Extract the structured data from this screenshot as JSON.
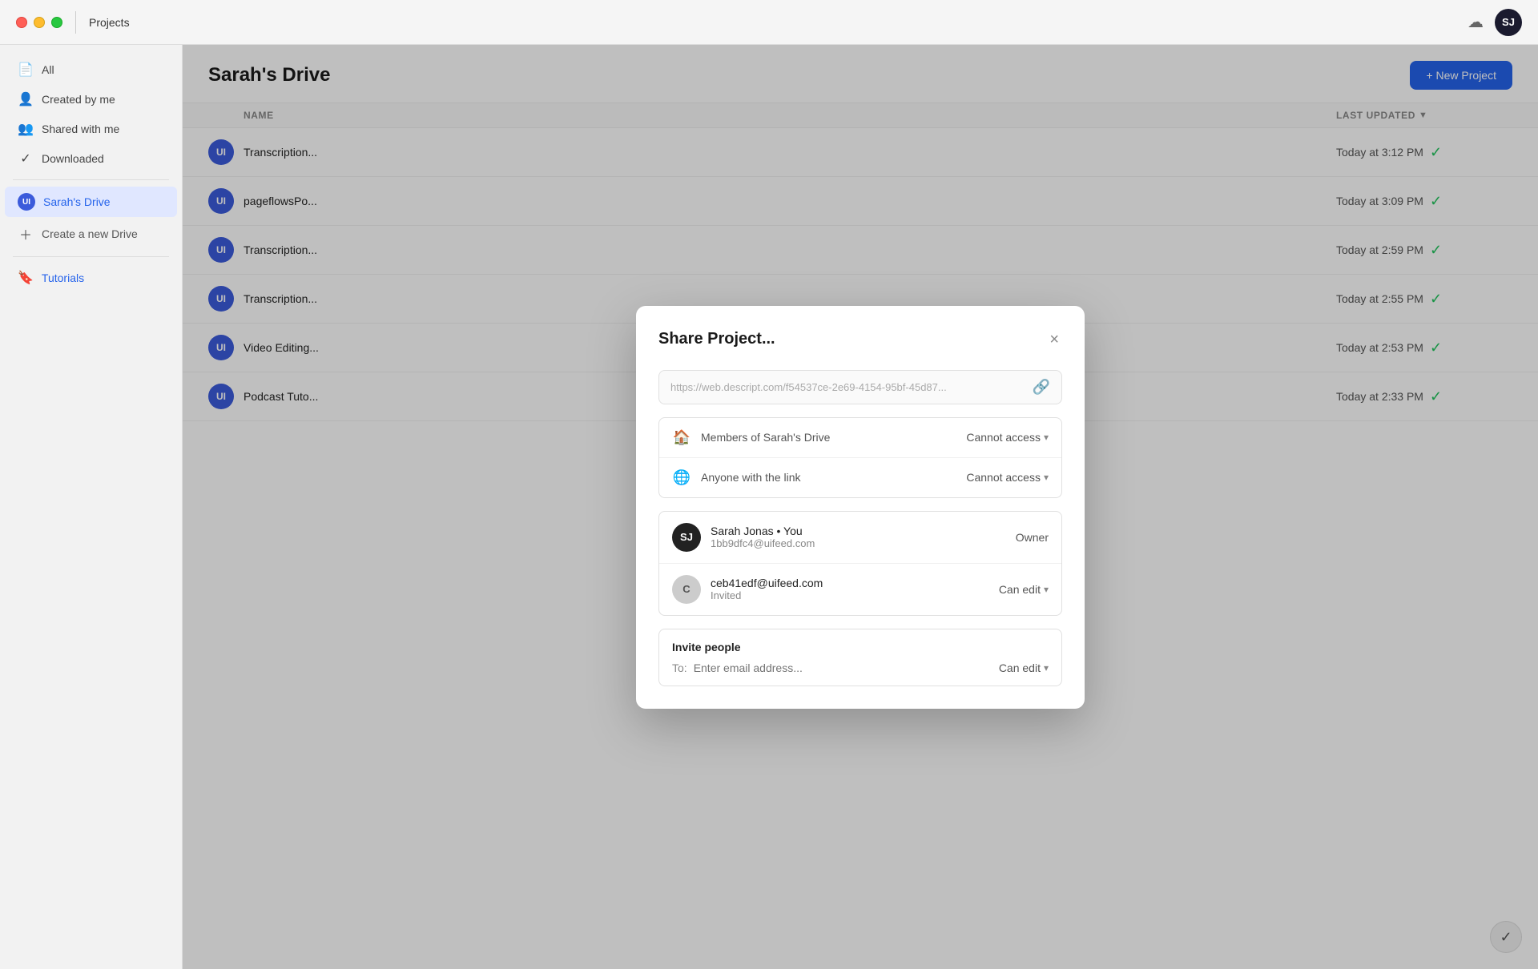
{
  "titlebar": {
    "title": "Projects",
    "avatar_label": "SJ"
  },
  "sidebar": {
    "items": [
      {
        "id": "all",
        "label": "All",
        "icon": "📄"
      },
      {
        "id": "created-by-me",
        "label": "Created by me",
        "icon": "👤"
      },
      {
        "id": "shared-with-me",
        "label": "Shared with me",
        "icon": "👥"
      },
      {
        "id": "downloaded",
        "label": "Downloaded",
        "icon": "✓"
      }
    ],
    "drive_label": "Sarah's Drive",
    "drive_initials": "UI",
    "create_drive_label": "Create a new Drive",
    "tutorials_label": "Tutorials"
  },
  "main": {
    "title": "Sarah's Drive",
    "new_project_label": "+ New Project",
    "table": {
      "col_name": "NAME",
      "col_updated": "LAST UPDATED",
      "rows": [
        {
          "initials": "UI",
          "name": "Transcription...",
          "updated": "Today at 3:12 PM"
        },
        {
          "initials": "UI",
          "name": "pageflowsPo...",
          "updated": "Today at 3:09 PM"
        },
        {
          "initials": "UI",
          "name": "Transcription...",
          "updated": "Today at 2:59 PM"
        },
        {
          "initials": "UI",
          "name": "Transcription...",
          "updated": "Today at 2:55 PM"
        },
        {
          "initials": "UI",
          "name": "Video Editing...",
          "updated": "Today at 2:53 PM"
        },
        {
          "initials": "UI",
          "name": "Podcast Tuto...",
          "updated": "Today at 2:33 PM"
        }
      ]
    }
  },
  "modal": {
    "title": "Share Project...",
    "close_label": "×",
    "url": "https://web.descript.com/f54537ce-2e69-4154-95bf-45d87...",
    "access_rows": [
      {
        "id": "members",
        "icon": "🏠",
        "label": "Members of Sarah's Drive",
        "permission": "Cannot access"
      },
      {
        "id": "anyone",
        "icon": "🌐",
        "label": "Anyone with the link",
        "permission": "Cannot access"
      }
    ],
    "members": [
      {
        "id": "sarah",
        "initials": "SJ",
        "avatar_style": "dark",
        "name": "Sarah Jonas • You",
        "email": "1bb9dfc4@uifeed.com",
        "role": "Owner"
      },
      {
        "id": "ceb",
        "initials": "C",
        "avatar_style": "gray",
        "name": "ceb41edf@uifeed.com",
        "email": "Invited",
        "role": "Can edit",
        "has_chevron": true
      }
    ],
    "invite": {
      "section_label": "Invite people",
      "to_label": "To:",
      "placeholder": "Enter email address...",
      "permission": "Can edit"
    }
  },
  "colors": {
    "accent_blue": "#2563eb",
    "drive_bg": "#3b5bdb",
    "check_green": "#22c55e"
  }
}
